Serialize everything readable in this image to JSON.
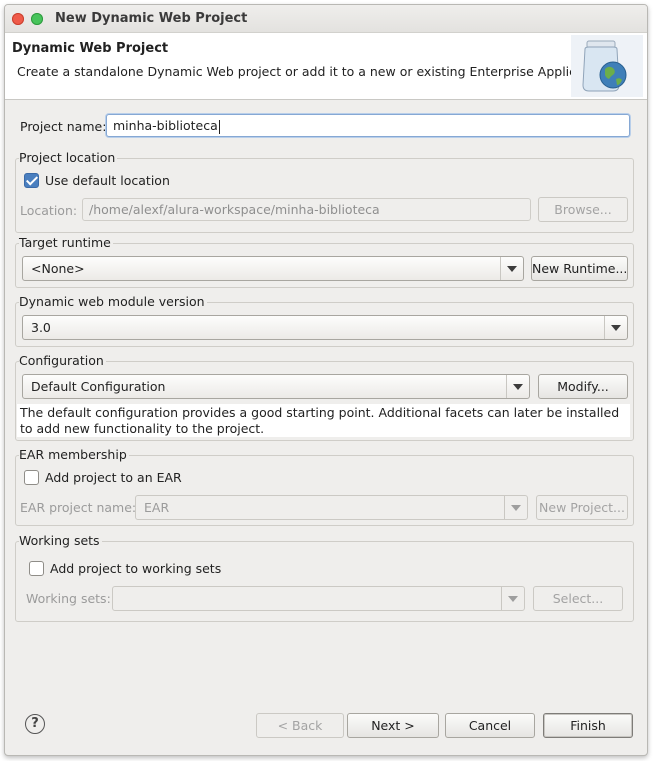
{
  "window": {
    "title": "New Dynamic Web Project"
  },
  "header": {
    "title": "Dynamic Web Project",
    "description": "Create a standalone Dynamic Web project or add it to a new or existing Enterprise Application.",
    "image_icon": "jar-globe-icon"
  },
  "project_name": {
    "label": "Project name:",
    "value": "minha-biblioteca"
  },
  "project_location": {
    "title": "Project location",
    "use_default_label": "Use default location",
    "use_default_checked": true,
    "location_label": "Location:",
    "location_value": "/home/alexf/alura-workspace/minha-biblioteca",
    "browse_label": "Browse..."
  },
  "target_runtime": {
    "title": "Target runtime",
    "selected": "<None>",
    "new_runtime_label": "New Runtime..."
  },
  "module_version": {
    "title": "Dynamic web module version",
    "selected": "3.0"
  },
  "configuration": {
    "title": "Configuration",
    "selected": "Default Configuration",
    "modify_label": "Modify...",
    "description": "The default configuration provides a good starting point. Additional facets can later be installed to add new functionality to the project."
  },
  "ear_membership": {
    "title": "EAR membership",
    "add_label": "Add project to an EAR",
    "add_checked": false,
    "ear_name_label": "EAR project name:",
    "ear_name_value": "EAR",
    "new_project_label": "New Project..."
  },
  "working_sets": {
    "title": "Working sets",
    "add_label": "Add project to working sets",
    "add_checked": false,
    "sets_label": "Working sets:",
    "sets_value": "",
    "select_label": "Select..."
  },
  "footer": {
    "help_symbol": "?",
    "back_label": "< Back",
    "next_label": "Next >",
    "cancel_label": "Cancel",
    "finish_label": "Finish"
  }
}
